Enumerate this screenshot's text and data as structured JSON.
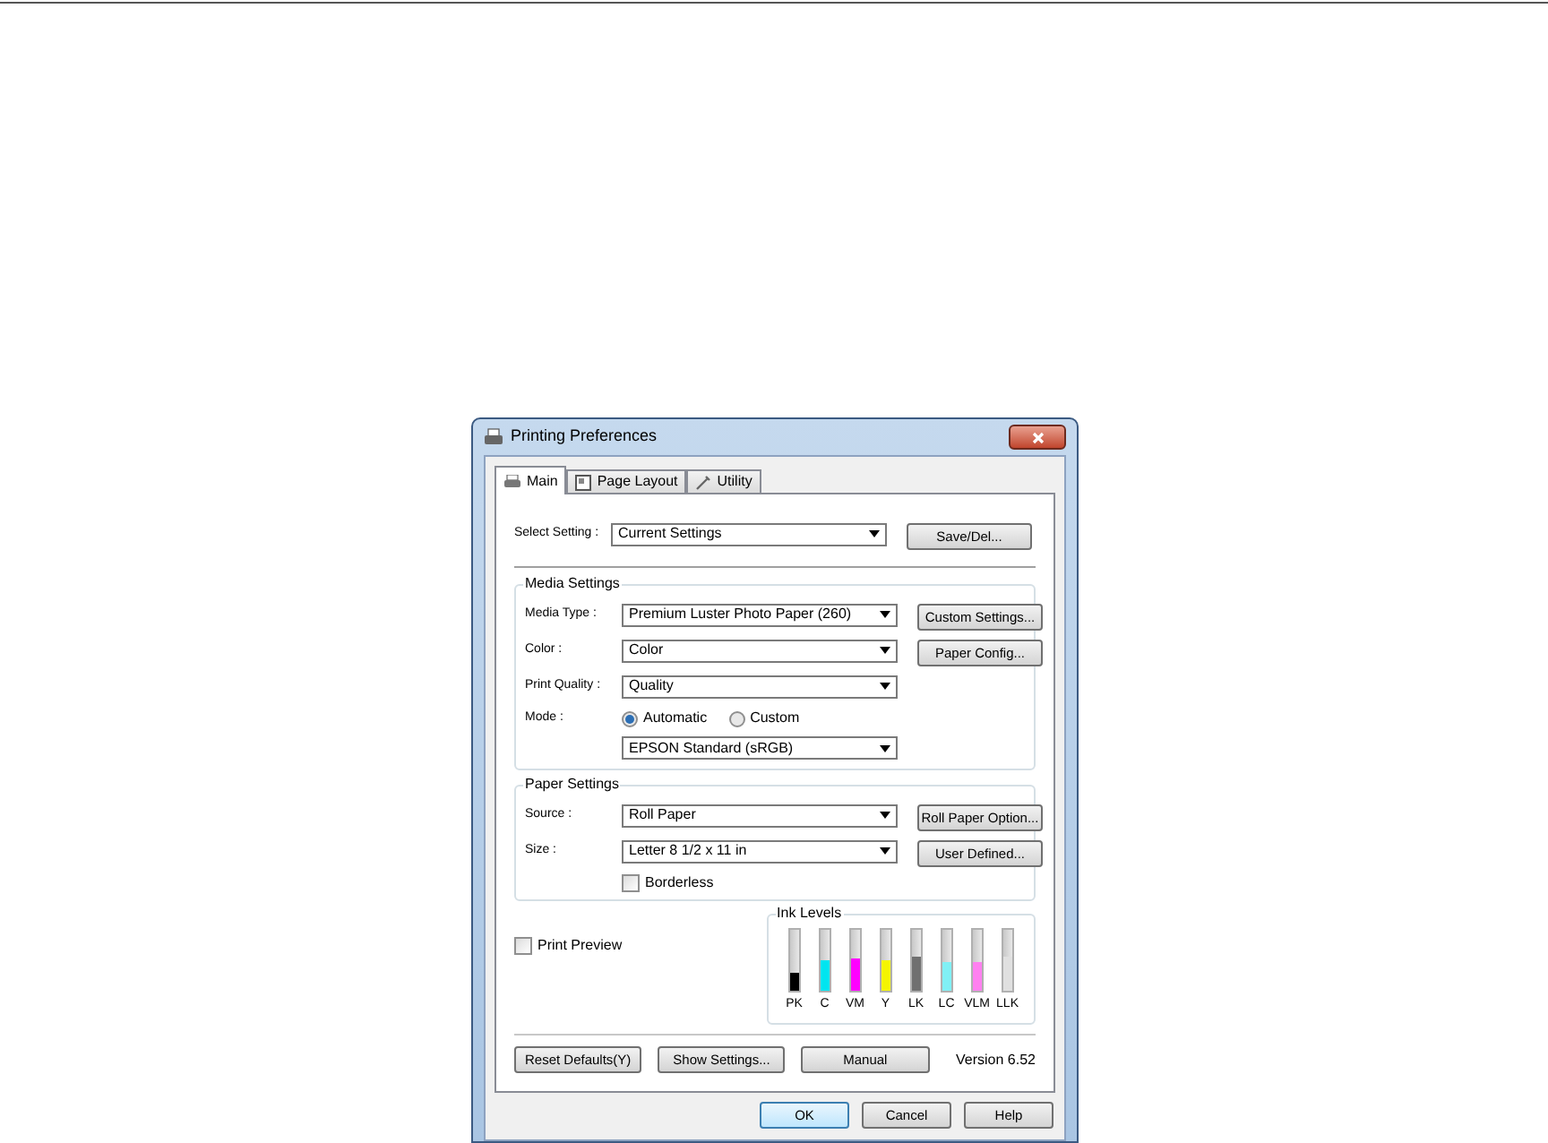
{
  "window": {
    "title": "Printing Preferences"
  },
  "tabs": [
    {
      "label": "Main",
      "selected": true
    },
    {
      "label": "Page Layout",
      "selected": false
    },
    {
      "label": "Utility",
      "selected": false
    }
  ],
  "select_setting": {
    "label": "Select Setting :",
    "value": "Current Settings",
    "button": "Save/Del..."
  },
  "media_settings": {
    "title": "Media Settings",
    "rows": [
      {
        "label": "Media Type :",
        "value": "Premium Luster Photo Paper (260)",
        "button": "Custom Settings..."
      },
      {
        "label": "Color :",
        "value": "Color",
        "button": "Paper Config..."
      },
      {
        "label": "Print Quality :",
        "value": "Quality"
      }
    ],
    "mode": {
      "label": "Mode :",
      "options": [
        {
          "label": "Automatic",
          "selected": true
        },
        {
          "label": "Custom",
          "selected": false
        }
      ],
      "value": "EPSON Standard (sRGB)"
    }
  },
  "paper_settings": {
    "title": "Paper Settings",
    "rows": [
      {
        "label": "Source :",
        "value": "Roll Paper",
        "button": "Roll Paper Option..."
      },
      {
        "label": "Size :",
        "value": "Letter 8 1/2 x 11 in",
        "button": "User Defined..."
      }
    ],
    "borderless": {
      "label": "Borderless",
      "checked": false
    }
  },
  "print_preview": {
    "label": "Print Preview",
    "checked": false
  },
  "ink_levels": {
    "title": "Ink Levels",
    "inks": [
      {
        "name": "PK",
        "level": 0.3,
        "color": "#000000"
      },
      {
        "name": "C",
        "level": 0.5,
        "color": "#00e5f0"
      },
      {
        "name": "VM",
        "level": 0.52,
        "color": "#ff00ff"
      },
      {
        "name": "Y",
        "level": 0.5,
        "color": "#f5f500"
      },
      {
        "name": "LK",
        "level": 0.55,
        "color": "#707070"
      },
      {
        "name": "LC",
        "level": 0.48,
        "color": "#80f0f5"
      },
      {
        "name": "VLM",
        "level": 0.48,
        "color": "#ff80f0"
      },
      {
        "name": "LLK",
        "level": 0.55,
        "color": "#e0e0e0"
      }
    ]
  },
  "buttons": [
    "Reset Defaults(Y)",
    "Show Settings...",
    "Manual"
  ],
  "version": "Version 6.52",
  "dialog_buttons": [
    {
      "label": "OK",
      "kind": "default"
    },
    {
      "label": "Cancel",
      "kind": "normal"
    },
    {
      "label": "Help",
      "kind": "normal"
    }
  ]
}
